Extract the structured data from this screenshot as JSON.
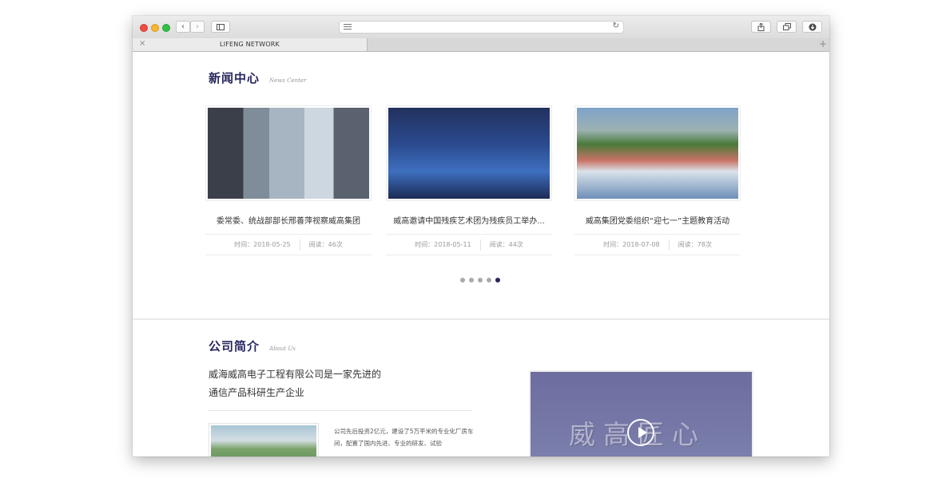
{
  "browser": {
    "tab_title": "LIFENG NETWORK",
    "tab_close": "×",
    "new_tab": "+",
    "back": "‹",
    "forward": "›",
    "reload": "↻"
  },
  "news": {
    "title_cn": "新闻中心",
    "title_en": "News Center",
    "cards": [
      {
        "title": "委常委、统战部部长邢善萍视察威高集团",
        "date": "时间：2018-05-25",
        "views": "阅读：46次"
      },
      {
        "title": "威高邀请中国残疾艺术团为残疾员工举办...",
        "date": "时间：2018-05-11",
        "views": "阅读：44次"
      },
      {
        "title": "威高集团党委组织“迎七一”主题教育活动",
        "date": "时间：2018-07-08",
        "views": "阅读：78次"
      }
    ],
    "pager": {
      "count": 5,
      "active": 5
    }
  },
  "about": {
    "title_cn": "公司简介",
    "title_en": "About Us",
    "headline_1": "威海威高电子工程有限公司是一家先进的",
    "headline_2": "通信产品科研生产企业",
    "body": "公司先后投资2亿元，建设了5万平米的专业化厂房车间，配置了国内先进、专业的研发、试验",
    "video_caption": "威高匠心"
  },
  "colors": {
    "accent": "#27265e",
    "divider": "#eaeaea"
  }
}
